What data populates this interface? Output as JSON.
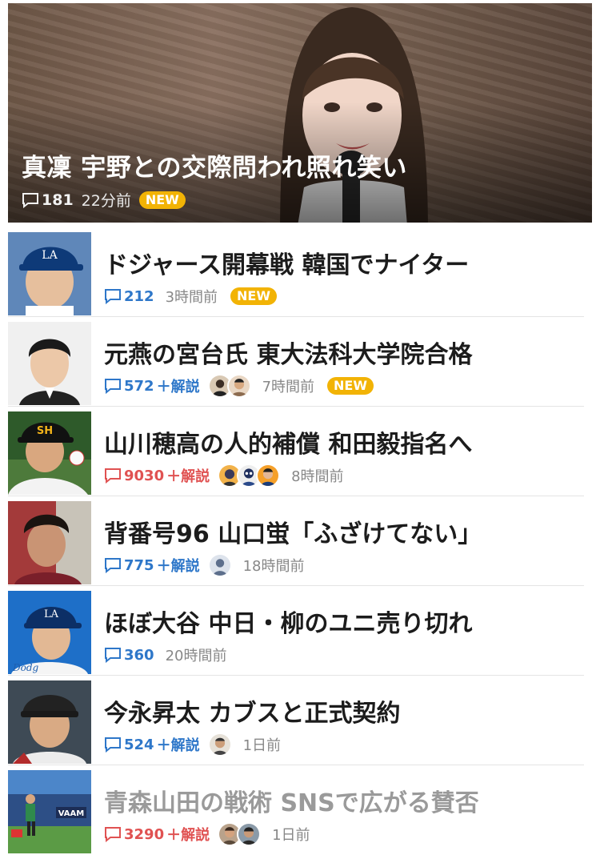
{
  "hero": {
    "title": "真凜 宇野との交際問われ照れ笑い",
    "comments": "181",
    "time": "22分前",
    "badge": "NEW"
  },
  "colors": {
    "comment_blue": "#2e77c9",
    "comment_red": "#e05252",
    "new_badge": "#f2b305"
  },
  "articles": [
    {
      "title": "ドジャース開幕戦 韓国でナイター",
      "comments": "212",
      "extra": "",
      "time": "3時間前",
      "badge": "NEW"
    },
    {
      "title": "元燕の宮台氏 東大法科大学院合格",
      "comments": "572",
      "extra": "＋解説",
      "time": "7時間前",
      "badge": "NEW"
    },
    {
      "title": "山川穂高の人的補償 和田毅指名へ",
      "comments": "9030",
      "extra": "＋解説",
      "time": "8時間前",
      "badge": ""
    },
    {
      "title": "背番号96 山口蛍「ふざけてない」",
      "comments": "775",
      "extra": "＋解説",
      "time": "18時間前",
      "badge": ""
    },
    {
      "title": "ほぼ大谷 中日・柳のユニ売り切れ",
      "comments": "360",
      "extra": "",
      "time": "20時間前",
      "badge": ""
    },
    {
      "title": "今永昇太 カブスと正式契約",
      "comments": "524",
      "extra": "＋解説",
      "time": "1日前",
      "badge": ""
    },
    {
      "title": "青森山田の戦術 SNSで広がる賛否",
      "comments": "3290",
      "extra": "＋解説",
      "time": "1日前",
      "badge": ""
    }
  ]
}
